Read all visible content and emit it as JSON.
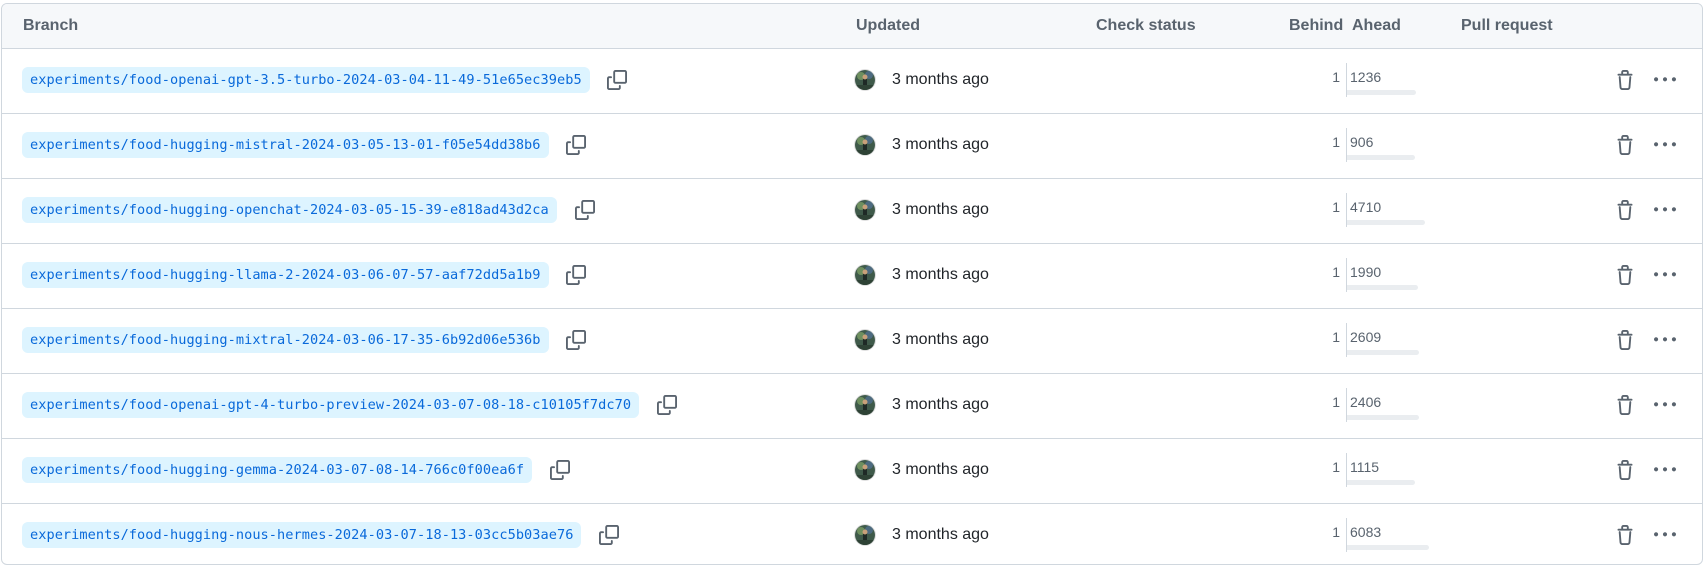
{
  "headers": {
    "branch": "Branch",
    "updated": "Updated",
    "check_status": "Check status",
    "behind": "Behind",
    "ahead": "Ahead",
    "pull_request": "Pull request"
  },
  "colors": {
    "branch_bg": "#ddf4ff",
    "branch_text": "#0969da",
    "header_bg": "#f6f8fa",
    "border": "#d0d7de",
    "muted": "#59636e"
  },
  "icons": {
    "copy": "copy-icon",
    "delete": "trash-icon",
    "more": "kebab-horizontal-icon",
    "avatar": "user-avatar"
  },
  "branches": [
    {
      "name": "experiments/food-openai-gpt-3.5-turbo-2024-03-04-11-49-51e65ec39eb5",
      "updated": "3 months ago",
      "behind": "1",
      "ahead": "1236"
    },
    {
      "name": "experiments/food-hugging-mistral-2024-03-05-13-01-f05e54dd38b6",
      "updated": "3 months ago",
      "behind": "1",
      "ahead": "906"
    },
    {
      "name": "experiments/food-hugging-openchat-2024-03-05-15-39-e818ad43d2ca",
      "updated": "3 months ago",
      "behind": "1",
      "ahead": "4710"
    },
    {
      "name": "experiments/food-hugging-llama-2-2024-03-06-07-57-aaf72dd5a1b9",
      "updated": "3 months ago",
      "behind": "1",
      "ahead": "1990"
    },
    {
      "name": "experiments/food-hugging-mixtral-2024-03-06-17-35-6b92d06e536b",
      "updated": "3 months ago",
      "behind": "1",
      "ahead": "2609"
    },
    {
      "name": "experiments/food-openai-gpt-4-turbo-preview-2024-03-07-08-18-c10105f7dc70",
      "updated": "3 months ago",
      "behind": "1",
      "ahead": "2406"
    },
    {
      "name": "experiments/food-hugging-gemma-2024-03-07-08-14-766c0f00ea6f",
      "updated": "3 months ago",
      "behind": "1",
      "ahead": "1115"
    },
    {
      "name": "experiments/food-hugging-nous-hermes-2024-03-07-18-13-03cc5b03ae76",
      "updated": "3 months ago",
      "behind": "1",
      "ahead": "6083"
    }
  ]
}
